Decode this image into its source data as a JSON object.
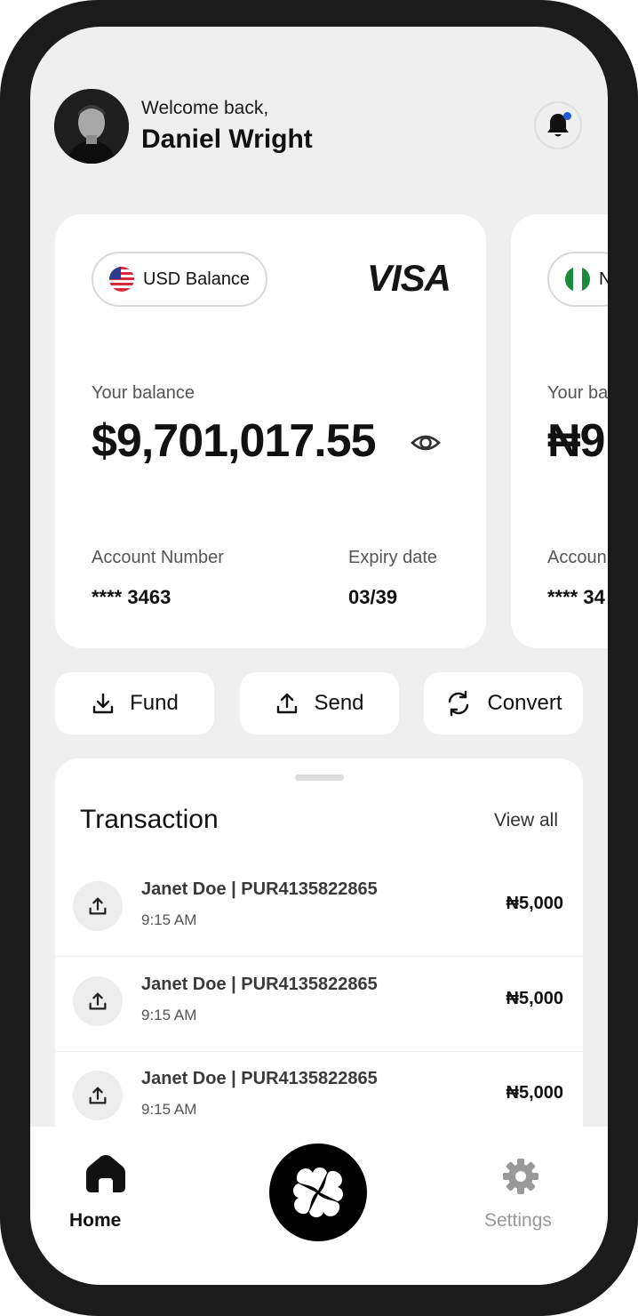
{
  "header": {
    "welcome": "Welcome back,",
    "user_name": "Daniel Wright",
    "avatar_icon": "avatar-photo",
    "notification_icon": "bell-icon",
    "notification_dot_color": "#1f5bd8"
  },
  "cards": [
    {
      "currency_label": "USD Balance",
      "flag": "us-flag-icon",
      "brand": "VISA",
      "balance_label": "Your balance",
      "balance": "$9,701,017.55",
      "account_label": "Account Number",
      "account_number": "**** 3463",
      "expiry_label": "Expiry date",
      "expiry": "03/39"
    },
    {
      "currency_label": "N",
      "flag": "ng-flag-icon",
      "balance_label": "Your ba",
      "balance": "₦9,",
      "account_label": "Accoun",
      "account_number": "**** 34"
    }
  ],
  "actions": [
    {
      "label": "Fund",
      "icon": "download-icon"
    },
    {
      "label": "Send",
      "icon": "upload-icon"
    },
    {
      "label": "Convert",
      "icon": "refresh-icon"
    }
  ],
  "transactions": {
    "title": "Transaction",
    "view_all": "View all",
    "items": [
      {
        "name": "Janet Doe | PUR4135822865",
        "time": "9:15 AM",
        "amount": "₦5,000",
        "icon": "upload-icon"
      },
      {
        "name": "Janet Doe | PUR4135822865",
        "time": "9:15 AM",
        "amount": "₦5,000",
        "icon": "upload-icon"
      },
      {
        "name": "Janet Doe | PUR4135822865",
        "time": "9:15 AM",
        "amount": "₦5,000",
        "icon": "upload-icon"
      }
    ]
  },
  "nav": {
    "home_label": "Home",
    "settings_label": "Settings",
    "center_icon": "clover-icon"
  }
}
